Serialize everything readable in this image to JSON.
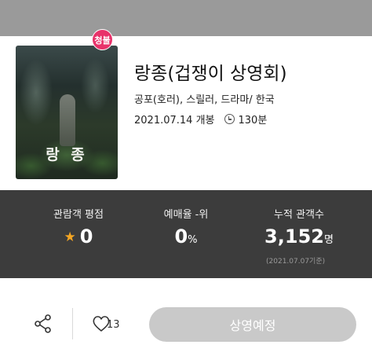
{
  "movie": {
    "title": "랑종(겁쟁이 상영회)",
    "genre_line": "공포(호러), 스릴러, 드라마/ 한국",
    "release": "2021.07.14 개봉",
    "runtime": "130분",
    "age_rating_badge": "청불",
    "poster": {
      "title": "랑 종",
      "tagline": "",
      "subline": ""
    }
  },
  "stats": {
    "audience_rating": {
      "label": "관람객 평점",
      "value": "0"
    },
    "booking_rate": {
      "label": "예매율 -위",
      "value": "0",
      "unit": "%"
    },
    "cumulative_audience": {
      "label": "누적 관객수",
      "value": "3,152",
      "unit": "명",
      "note": "(2021.07.07기준)"
    }
  },
  "actions": {
    "like_count": "13",
    "cta_label": "상영예정"
  },
  "colors": {
    "badge": "#e8326a",
    "stats_bg": "#3c3c3c",
    "star": "#f5a623",
    "cta_bg": "#c9c9c9"
  }
}
